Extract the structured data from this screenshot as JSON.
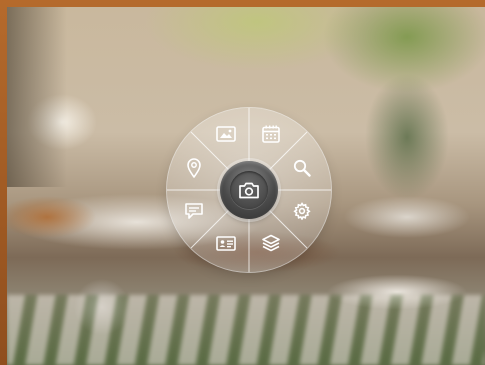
{
  "radial_menu": {
    "center": {
      "icon": "camera-icon"
    },
    "items": [
      {
        "icon": "image-icon"
      },
      {
        "icon": "calendar-icon"
      },
      {
        "icon": "search-icon"
      },
      {
        "icon": "settings-gear-icon"
      },
      {
        "icon": "layers-icon"
      },
      {
        "icon": "contact-card-icon"
      },
      {
        "icon": "chat-bubble-icon"
      },
      {
        "icon": "location-pin-icon"
      }
    ]
  },
  "colors": {
    "frame": "#a25a22",
    "icon_stroke": "#ffffff",
    "center_dark": "#3b3b3b"
  }
}
